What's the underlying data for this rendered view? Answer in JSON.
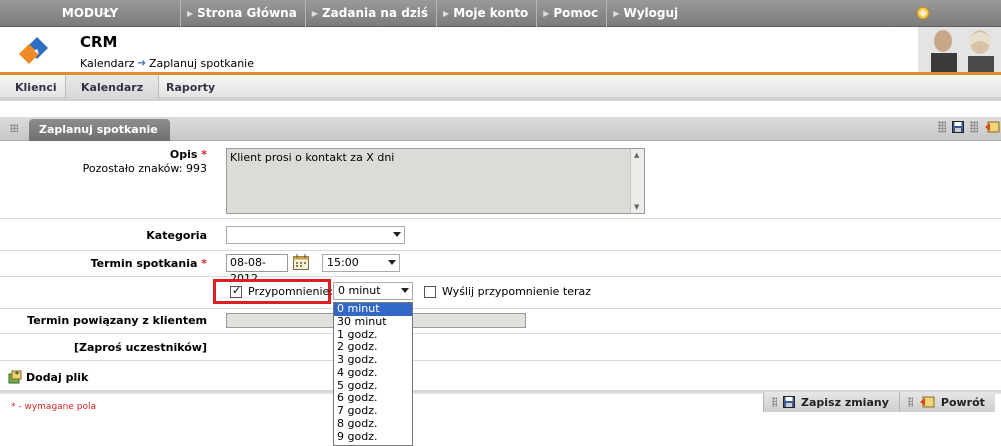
{
  "topnav": {
    "modules_label": "MODUŁY",
    "links": [
      {
        "label": "Strona Główna"
      },
      {
        "label": "Zadania na dziś"
      },
      {
        "label": "Moje konto"
      },
      {
        "label": "Pomoc"
      },
      {
        "label": "Wyloguj"
      }
    ]
  },
  "header": {
    "app_title": "CRM",
    "breadcrumb": [
      "Kalendarz",
      "Zaplanuj spotkanie"
    ]
  },
  "tabs": [
    {
      "label": "Klienci"
    },
    {
      "label": "Kalendarz"
    },
    {
      "label": "Raporty"
    }
  ],
  "panel": {
    "title": "Zaplanuj spotkanie"
  },
  "form": {
    "opis_label": "Opis",
    "required_mark": "*",
    "remaining_chars": "Pozostało znaków: 993",
    "opis_value": "Klient prosi o kontakt za X dni",
    "kategoria_label": "Kategoria",
    "kategoria_value": "",
    "termin_label": "Termin spotkania",
    "date_value": "08-08-2012",
    "time_value": "15:00",
    "reminder_label": "Przypomnienie:",
    "reminder_checked": true,
    "reminder_selected": "0 minut",
    "send_now_label": "Wyślij przypomnienie teraz",
    "related_label": "Termin powiązany z klientem",
    "invite_label": "[Zaproś uczestników]"
  },
  "reminder_options": [
    "0 minut",
    "30 minut",
    "1 godz.",
    "2 godz.",
    "3 godz.",
    "4 godz.",
    "5 godz.",
    "6 godz.",
    "7 godz.",
    "8 godz.",
    "9 godz."
  ],
  "add_file_label": "Dodaj plik",
  "required_note": "* - wymagane pola",
  "actions": {
    "save_label": "Zapisz zmiany",
    "back_label": "Powrót"
  },
  "colors": {
    "accent_orange": "#e68a2e",
    "required_red": "#d22222",
    "highlight_red": "#e01c24",
    "selection_blue": "#3168c6"
  }
}
